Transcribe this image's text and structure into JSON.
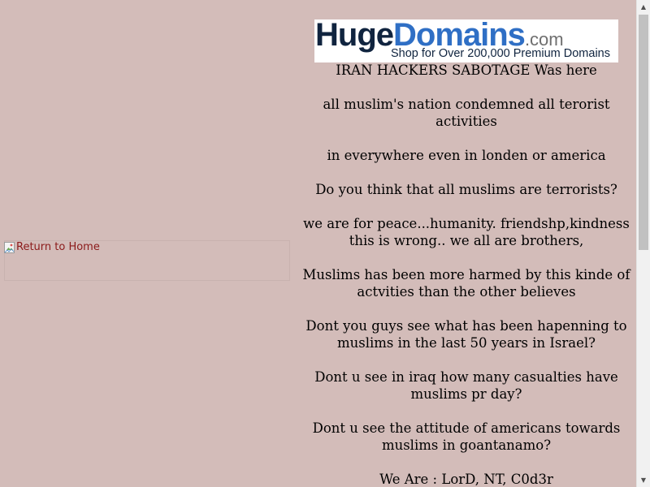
{
  "left": {
    "return_link_alt": "Return to Home",
    "icon": "broken-image-icon"
  },
  "banner": {
    "brand_huge": "Huge",
    "brand_domains": "Domains",
    "brand_tld": ".com",
    "tagline": "Shop for Over 200,000 Premium Domains"
  },
  "message": {
    "lines": [
      "IRAN HACKERS SABOTAGE Was here",
      "all muslim's nation condemned all terorist activities",
      "in everywhere even in londen or america",
      "Do you think that all muslims are terrorists?",
      "we are for peace...humanity. friendshp,kindness this is wrong.. we all are brothers,",
      "Muslims has been more harmed by this kinde of actvities than the other believes",
      "Dont you guys see what has been hapenning to muslims in the last 50 years in Israel?",
      "Dont u see in iraq how many casualties have muslims pr day?",
      "Dont u see the attitude of americans towards muslims in goantanamo?",
      "We Are : LorD, NT, C0d3r"
    ]
  },
  "scrollbar": {
    "up_icon": "arrow-up-icon",
    "down_icon": "arrow-down-icon"
  },
  "colors": {
    "background": "#d3bcb9",
    "link": "#8b1a1a",
    "brand_dark": "#10243f",
    "brand_blue": "#2f6fc5"
  }
}
